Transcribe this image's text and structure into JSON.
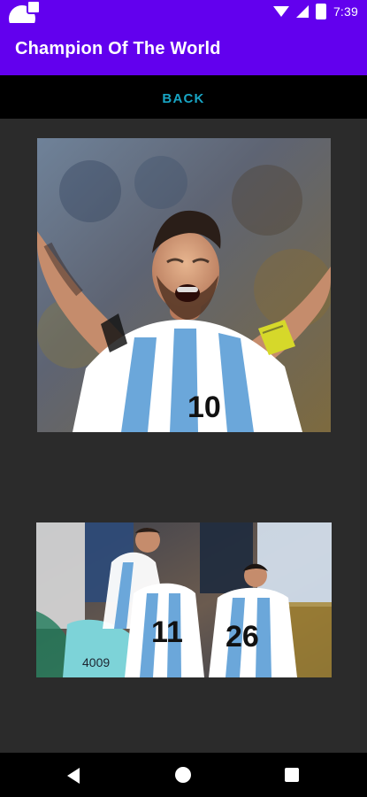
{
  "status_bar": {
    "time": "7:39"
  },
  "app_bar": {
    "title": "Champion Of The World"
  },
  "back_bar": {
    "label": "BACK"
  },
  "images": [
    {
      "jersey_number": "10"
    },
    {
      "jersey_numbers": [
        "11",
        "26"
      ],
      "bib": "4009"
    }
  ],
  "colors": {
    "primary": "#6200EE",
    "back_text": "#18A5C4",
    "content_bg": "#2B2B2B",
    "nav_bg": "#000000"
  },
  "icons": {
    "status_left": "app-icon",
    "status_right": [
      "wifi-icon",
      "signal-icon",
      "battery-icon"
    ],
    "nav": [
      "back-icon",
      "home-icon",
      "recents-icon"
    ]
  }
}
